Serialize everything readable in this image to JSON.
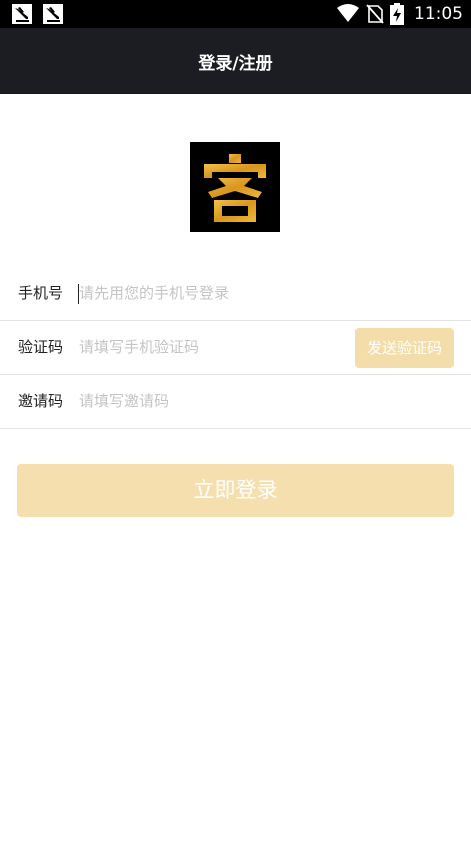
{
  "status_bar": {
    "time": "11:05",
    "icons": [
      "notification-icon",
      "notification-icon",
      "wifi-icon",
      "no-sim-icon",
      "battery-charging-icon"
    ]
  },
  "header": {
    "title": "登录/注册"
  },
  "logo": {
    "char": "客",
    "colors": {
      "background": "#000000",
      "gold": "#e3a92f"
    }
  },
  "form": {
    "phone": {
      "label": "手机号",
      "placeholder": "请先用您的手机号登录",
      "value": ""
    },
    "code": {
      "label": "验证码",
      "placeholder": "请填写手机验证码",
      "value": "",
      "send_label": "发送验证码"
    },
    "invite": {
      "label": "邀请码",
      "placeholder": "请填写邀请码",
      "value": ""
    }
  },
  "login_label": "立即登录",
  "colors": {
    "header_bg": "#1c1d22",
    "accent_disabled": "#f5dfae",
    "placeholder": "#c4c4c4",
    "divider": "#e2e2e2"
  }
}
